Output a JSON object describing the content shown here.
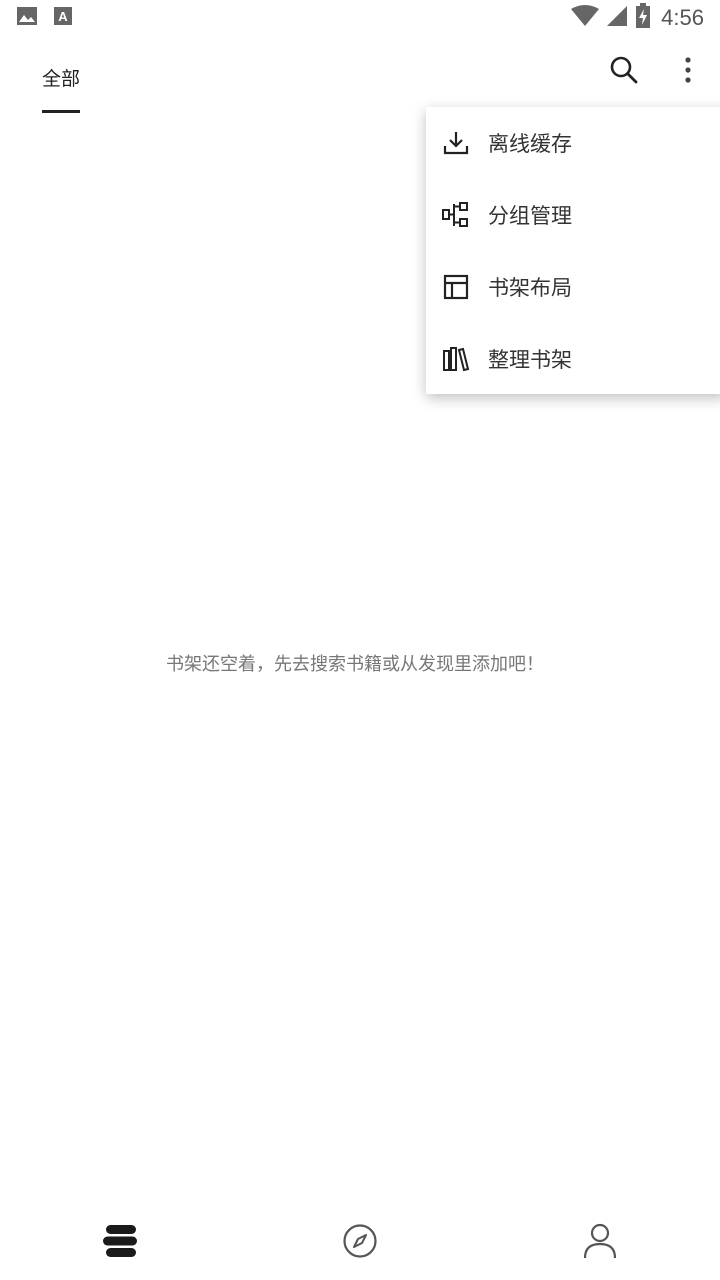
{
  "status_bar": {
    "time": "4:56",
    "icons": [
      "image-icon",
      "keyboard-a-icon",
      "wifi-icon",
      "cell-signal-icon",
      "battery-charging-icon"
    ]
  },
  "header": {
    "tabs": [
      {
        "label": "全部",
        "active": true
      }
    ],
    "actions": [
      "search-icon",
      "more-vert-icon"
    ]
  },
  "menu": {
    "items": [
      {
        "label": "离线缓存",
        "icon": "download-icon"
      },
      {
        "label": "分组管理",
        "icon": "group-manage-icon"
      },
      {
        "label": "书架布局",
        "icon": "layout-icon"
      },
      {
        "label": "整理书架",
        "icon": "books-icon"
      }
    ]
  },
  "empty_message": "书架还空着，先去搜索书籍或从发现里添加吧！",
  "bottom_nav": {
    "items": [
      {
        "name": "bookshelf",
        "icon": "bookshelf-icon",
        "active": true
      },
      {
        "name": "discover",
        "icon": "compass-icon",
        "active": false
      },
      {
        "name": "profile",
        "icon": "person-icon",
        "active": false
      }
    ]
  },
  "colors": {
    "accent": "#1a1a1a",
    "text_secondary": "#777777"
  }
}
